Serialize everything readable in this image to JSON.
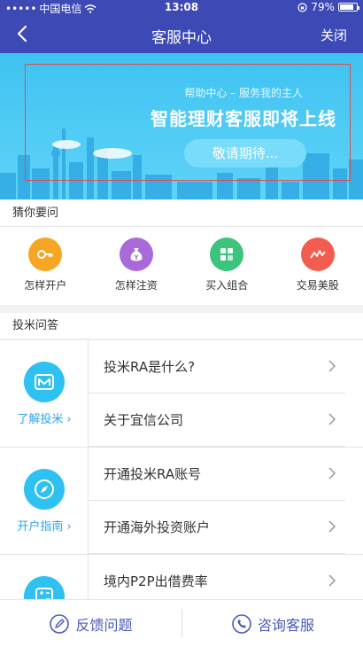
{
  "status_bar": {
    "carrier": "中国电信",
    "time": "13:08",
    "battery": "79%"
  },
  "nav": {
    "title": "客服中心",
    "close_label": "关闭"
  },
  "banner": {
    "subtitle": "帮助中心 – 服务我的主人",
    "headline": "智能理财客服即将上线",
    "cta_label": "敬请期待..."
  },
  "guess": {
    "title": "猜你要问",
    "items": [
      {
        "label": "怎样开户",
        "icon": "key-icon",
        "color": "#f6a623"
      },
      {
        "label": "怎样注资",
        "icon": "money-bag-icon",
        "color": "#a86ad9"
      },
      {
        "label": "买入组合",
        "icon": "grid-icon",
        "color": "#3cc47c"
      },
      {
        "label": "交易美股",
        "icon": "trend-chart-icon",
        "color": "#f35d4f"
      }
    ]
  },
  "qa": {
    "title": "投米问答",
    "groups": [
      {
        "link": "了解投米",
        "icon": "m-logo-icon",
        "questions": [
          "投米RA是什么?",
          "关于宜信公司"
        ]
      },
      {
        "link": "开户指南",
        "icon": "compass-icon",
        "questions": [
          "开通投米RA账号",
          "开通海外投资账户"
        ]
      },
      {
        "link": "",
        "icon": "calculator-icon",
        "questions": [
          "境内P2P出借费率"
        ]
      }
    ]
  },
  "bottom": {
    "feedback_label": "反馈问题",
    "consult_label": "咨询客服"
  }
}
